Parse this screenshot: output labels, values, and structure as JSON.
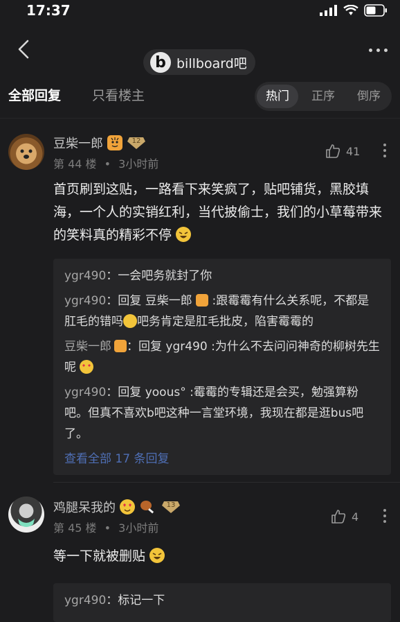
{
  "status": {
    "time": "17:37"
  },
  "nav": {
    "title": "billboard吧",
    "logo_letter": "b"
  },
  "tabs": {
    "all": "全部回复",
    "host_only": "只看楼主",
    "sort": [
      "热门",
      "正序",
      "倒序"
    ]
  },
  "posts": [
    {
      "user": "豆柴一郎",
      "level": "12",
      "floor": "第 44 楼",
      "dot": "•",
      "time": "3小时前",
      "likes": "41",
      "content": "首页刷到这贴，一路看下来笑疯了，贴吧铺货，黑胶填海，一个人的实销红利，当代披偷士，我们的小草莓带来的笑料真的精彩不停",
      "replies": [
        {
          "name": "ygr490",
          "sep": "：",
          "text": "一会吧务就封了你"
        },
        {
          "name": "ygr490",
          "sep": "：",
          "prefix": "回复 ",
          "target": "豆柴一郎",
          "text": " :跟霉霉有什么关系呢，不都是肛毛的错吗",
          "text2": "吧务肯定是肛毛批皮，陷害霉霉的"
        },
        {
          "name": "豆柴一郎",
          "sep": "：",
          "prefix": "回复 ",
          "target": "ygr490",
          "text": " :为什么不去问问神奇的柳树先生呢"
        },
        {
          "name": "ygr490",
          "sep": "：",
          "prefix": "回复 ",
          "target": "yoous°",
          "text": " :霉霉的专辑还是会买，勉强算粉吧。但真不喜欢b吧这种一言堂环境，我现在都是逛bus吧了。"
        }
      ],
      "view_all": "查看全部 17 条回复"
    },
    {
      "user": "鸡腿呆我的",
      "level": "13",
      "floor": "第 45 楼",
      "dot": "•",
      "time": "3小时前",
      "likes": "4",
      "content": "等一下就被删贴",
      "replies": [
        {
          "name": "ygr490",
          "sep": "：",
          "text": "标记一下"
        }
      ]
    }
  ],
  "colors": {
    "bg": "#1c1c1e",
    "card": "#262628",
    "link": "#4f6fb5",
    "level_badge": "#c9a86a"
  }
}
